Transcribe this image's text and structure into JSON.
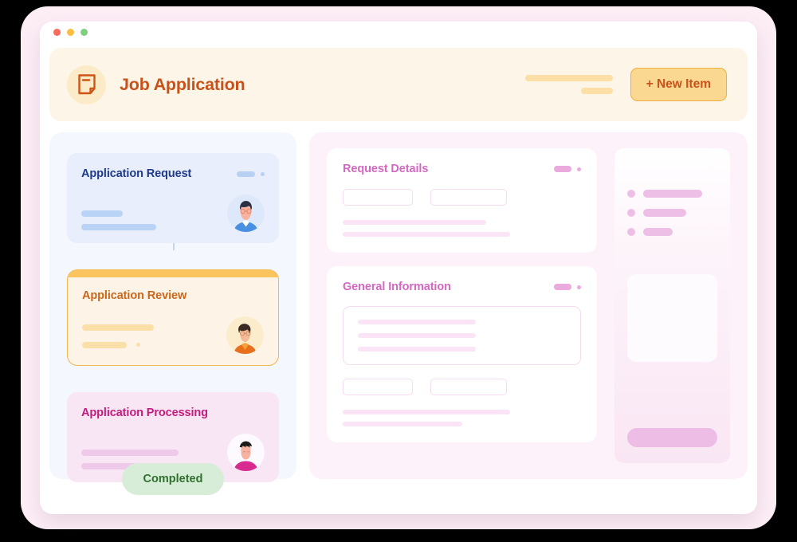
{
  "window": {
    "traffic_lights": [
      {
        "name": "close",
        "color": "#fb6a5b"
      },
      {
        "name": "minimize",
        "color": "#fdbd41"
      },
      {
        "name": "maximize",
        "color": "#7ed07f"
      }
    ]
  },
  "header": {
    "icon": "document-icon",
    "title": "Job Application",
    "title_color": "#c9511a",
    "background": "#fdf6e8",
    "new_item_button": {
      "label": "+ New Item",
      "background": "#fbd891",
      "border_color": "#f0ae3c",
      "text_color": "#c9511a"
    }
  },
  "pipeline": {
    "background": "#f4f7fd",
    "steps": [
      {
        "title": "Application Request",
        "theme": "blue",
        "title_color": "#1e3a8a",
        "background": "#e8eefb",
        "avatar": "avatar-man-glasses-blue"
      },
      {
        "title": "Application Review",
        "theme": "amber",
        "title_color": "#c9681a",
        "background": "#fdf3e7",
        "accent_color": "#fbc45f",
        "avatar": "avatar-person-curly-orange"
      },
      {
        "title": "Application Processing",
        "theme": "pink",
        "title_color": "#c21d7d",
        "background": "#f9e6f5",
        "avatar": "avatar-person-spiky-magenta"
      }
    ],
    "status_badge": {
      "label": "Completed",
      "background": "#d8edd7",
      "text_color": "#2f7031"
    }
  },
  "main": {
    "background": "#fdf2fa",
    "cards": [
      {
        "title": "Request Details",
        "title_color": "#d169c0"
      },
      {
        "title": "General Information",
        "title_color": "#d169c0"
      }
    ]
  },
  "sidebar": {
    "accent_color": "#edbfe6",
    "bullets": [
      {
        "name": "sidebar-bullet-item-1"
      },
      {
        "name": "sidebar-bullet-item-2"
      },
      {
        "name": "sidebar-bullet-item-3"
      }
    ]
  }
}
